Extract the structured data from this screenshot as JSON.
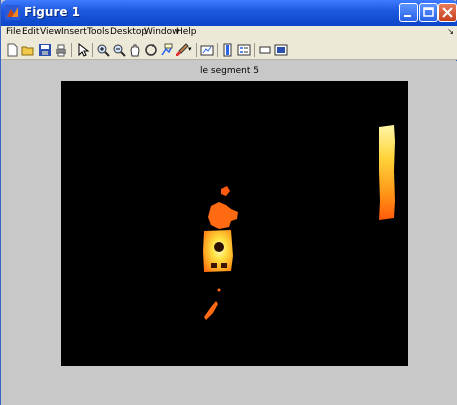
{
  "window": {
    "title": "Figure 1",
    "controls": {
      "minimize": "minimize",
      "maximize": "maximize",
      "close": "close"
    }
  },
  "menubar": {
    "items": [
      "File",
      "Edit",
      "View",
      "Insert",
      "Tools",
      "Desktop",
      "Window",
      "Help"
    ],
    "overflow_arrow": "↘"
  },
  "toolbar": {
    "icons": [
      "new-figure-icon",
      "open-file-icon",
      "save-icon",
      "print-icon",
      "select-arrow-icon",
      "zoom-in-icon",
      "zoom-out-icon",
      "pan-hand-icon",
      "rotate-3d-icon",
      "data-cursor-icon",
      "brush-icon",
      "link-plot-icon",
      "colorbar-icon",
      "legend-icon",
      "hide-plot-tools-icon",
      "show-plot-tools-icon"
    ]
  },
  "plot": {
    "title": "le segment 5",
    "background": "#000000",
    "colormap": "hot"
  },
  "colors": {
    "titlebar": "#0b45c8",
    "menubar": "#ece9d8",
    "figure_bg": "#c8c8c8"
  }
}
